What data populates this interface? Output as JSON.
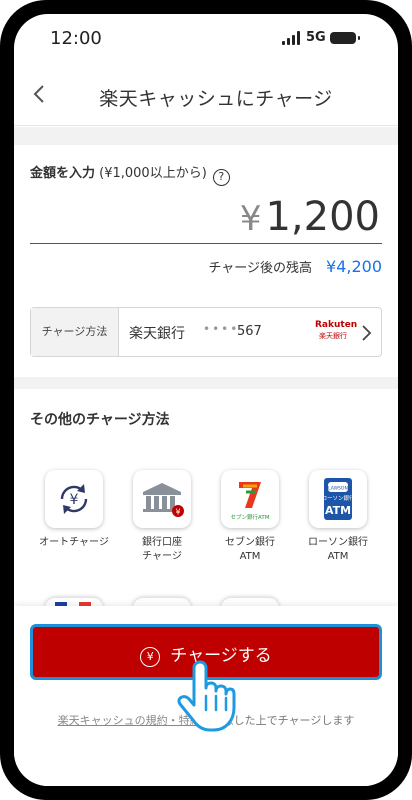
{
  "status_bar": {
    "time": "12:00",
    "network": "5G"
  },
  "header": {
    "title": "楽天キャッシュにチャージ"
  },
  "amount": {
    "label_bold": "金額を入力",
    "label_note": " (¥1,000以上から)",
    "help_symbol": "?",
    "currency_symbol": "¥",
    "value": "1,200",
    "balance_label": "チャージ後の残高",
    "balance_value": "¥4,200"
  },
  "method": {
    "label": "チャージ方法",
    "bank": "楽天銀行",
    "masked": "••••",
    "account_suffix": "567",
    "logo_text": "Rakuten",
    "logo_sub": "楽天銀行"
  },
  "other_methods": {
    "title": "その他のチャージ方法",
    "items": [
      {
        "label": "オートチャージ",
        "icon": "auto-charge-icon"
      },
      {
        "label": "銀行口座\nチャージ",
        "icon": "bank-account-icon"
      },
      {
        "label": "セブン銀行\nATM",
        "icon": "seven-bank-icon"
      },
      {
        "label": "ローソン銀行\nATM",
        "icon": "lawson-bank-icon"
      }
    ],
    "seven_logo_text": "セブン銀行ATM",
    "lawson_logo_top": "LAWSON",
    "lawson_logo_mid": "ローソン銀行",
    "lawson_logo_atm": "ATM"
  },
  "footer": {
    "charge_button": "チャージする",
    "terms_link": "楽天キャッシュの規約・特約",
    "terms_text": "に同意した上でチャージします"
  },
  "colors": {
    "brand_red": "#bf0000",
    "accent_blue": "#1a73e8",
    "focus_outline": "#1e90d8"
  }
}
